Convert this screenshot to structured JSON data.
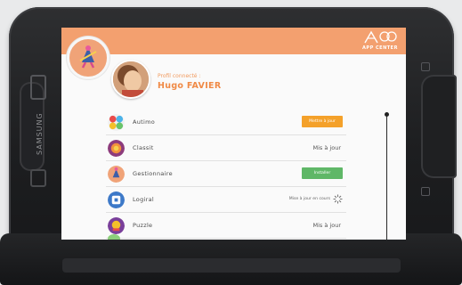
{
  "device": {
    "brand": "SAMSUNG"
  },
  "header": {
    "logo_text": "APP CENTER"
  },
  "profile": {
    "caption": "Profil connecté :",
    "name": "Hugo FAVIER"
  },
  "apps": [
    {
      "name": "Autimo",
      "action": "Mettre à jour",
      "action_color": "#f4a12a"
    },
    {
      "name": "Classit",
      "status": "Mis à jour"
    },
    {
      "name": "Gestionnaire",
      "action": "Installer",
      "action_color": "#5fb767"
    },
    {
      "name": "Logiral",
      "status": "Mise à jour en cours"
    },
    {
      "name": "Puzzle",
      "status": "Mis à jour"
    }
  ],
  "colors": {
    "header": "#f3a06f",
    "accent": "#f08a46",
    "update_button": "#f4a12a",
    "install_button": "#5fb767"
  }
}
